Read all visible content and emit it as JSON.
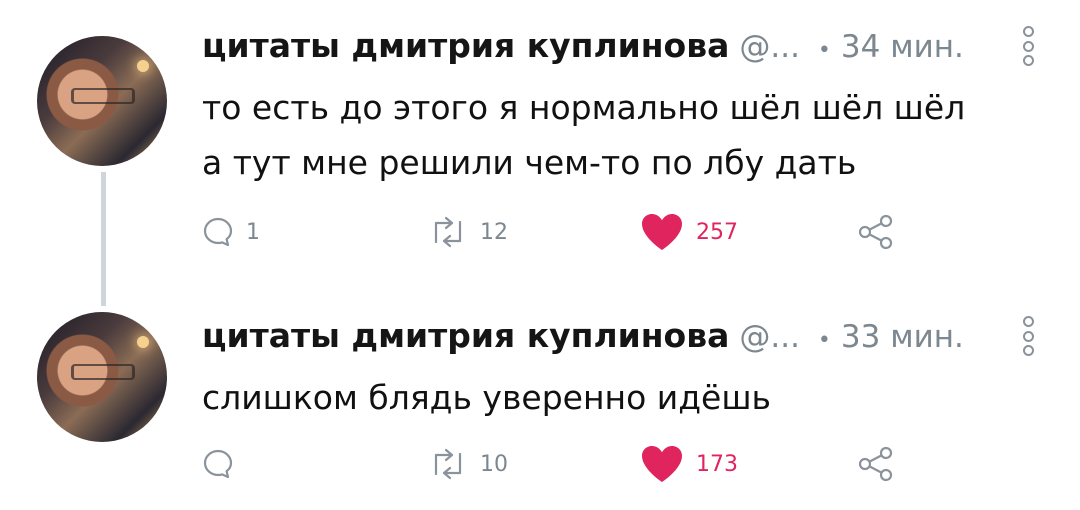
{
  "tweets": [
    {
      "author": "цитаты дмитрия куплинова",
      "handle": "@...",
      "separator": "•",
      "time": "34 мин.",
      "text_lines": [
        "то есть до этого я нормально шёл шёл шёл",
        "а тут мне решили чем-то по лбу дать"
      ],
      "replies": "1",
      "retweets": "12",
      "likes": "257",
      "liked": true,
      "icons": [
        "comment-icon",
        "retweet-icon",
        "heart-icon",
        "share-icon",
        "more-icon"
      ]
    },
    {
      "author": "цитаты дмитрия куплинова",
      "handle": "@...",
      "separator": "•",
      "time": "33 мин.",
      "text_lines": [
        "слишком блядь уверенно идёшь"
      ],
      "replies": "",
      "retweets": "10",
      "likes": "173",
      "liked": true,
      "icons": [
        "comment-icon",
        "retweet-icon",
        "heart-icon",
        "share-icon",
        "more-icon"
      ]
    }
  ],
  "colors": {
    "like": "#e0245e",
    "muted": "#7c8790",
    "thread_line": "#cfd5da"
  }
}
